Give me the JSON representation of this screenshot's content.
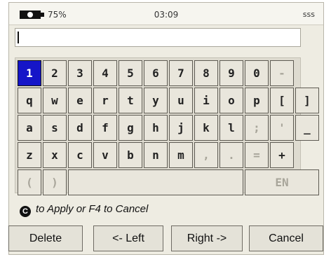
{
  "status": {
    "battery_pct": "75%",
    "time": "03:09",
    "user": "sss"
  },
  "input": {
    "value": ""
  },
  "keyboard": {
    "row1": [
      "1",
      "2",
      "3",
      "4",
      "5",
      "6",
      "7",
      "8",
      "9",
      "0",
      "-"
    ],
    "row2": [
      "q",
      "w",
      "e",
      "r",
      "t",
      "y",
      "u",
      "i",
      "o",
      "p",
      "[",
      "]"
    ],
    "row3": [
      "a",
      "s",
      "d",
      "f",
      "g",
      "h",
      "j",
      "k",
      "l",
      ";",
      "'",
      "_"
    ],
    "row4": [
      "z",
      "x",
      "c",
      "v",
      "b",
      "n",
      "m",
      ",",
      ".",
      "=",
      "+"
    ],
    "row5": {
      "lparen": "(",
      "rparen": ")",
      "space": "",
      "lang": "EN"
    },
    "selected": "1"
  },
  "hint": {
    "icon": "C",
    "text": "to Apply or F4 to Cancel"
  },
  "buttons": {
    "delete": "Delete",
    "left": "<- Left",
    "right": "Right ->",
    "cancel": "Cancel"
  }
}
